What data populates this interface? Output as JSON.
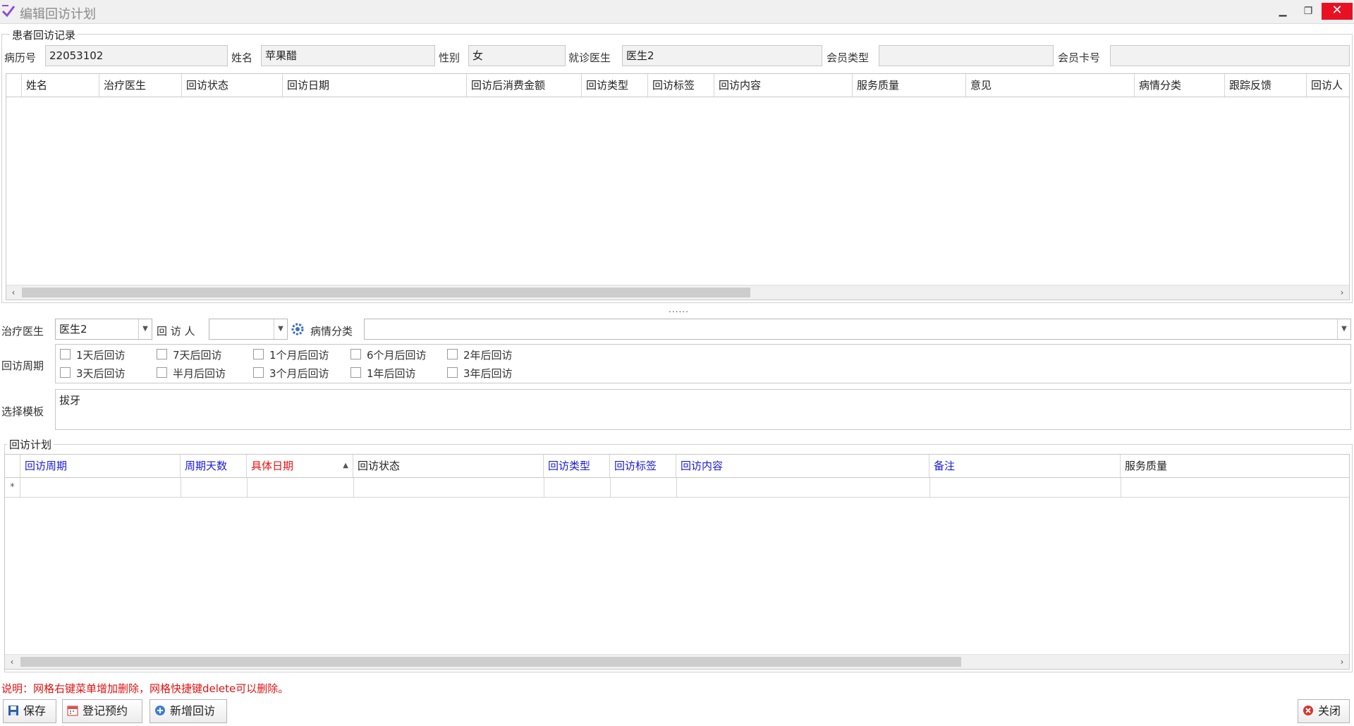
{
  "window": {
    "title": "编辑回访计划",
    "min_icon": "minimize-icon",
    "max_icon": "restore-icon",
    "close_icon": "close-icon"
  },
  "patient_group": {
    "legend": "患者回访记录",
    "fields": {
      "record_no_label": "病历号",
      "record_no": "22053102",
      "name_label": "姓名",
      "name": "苹果醋",
      "gender_label": "性别",
      "gender": "女",
      "doctor_label": "就诊医生",
      "doctor": "医生2",
      "member_type_label": "会员类型",
      "member_type": "",
      "member_card_label": "会员卡号",
      "member_card": ""
    },
    "grid_columns": [
      "姓名",
      "治疗医生",
      "回访状态",
      "回访日期",
      "回访后消费金额",
      "回访类型",
      "回访标签",
      "回访内容",
      "服务质量",
      "意见",
      "病情分类",
      "跟踪反馈",
      "回访人"
    ]
  },
  "splitter": "......",
  "form": {
    "treat_doctor_label": "治疗医生",
    "treat_doctor": "医生2",
    "visitor_label": "回 访 人",
    "visitor": "",
    "condition_label": "病情分类",
    "condition": "",
    "period_label": "回访周期",
    "periods_row1": [
      "1天后回访",
      "7天后回访",
      "1个月后回访",
      "6个月后回访",
      "2年后回访"
    ],
    "periods_row2": [
      "3天后回访",
      "半月后回访",
      "3个月后回访",
      "1年后回访",
      "3年后回访"
    ],
    "template_label": "选择模板",
    "template": "拔牙"
  },
  "plan_group": {
    "legend": "回访计划",
    "columns": [
      "回访周期",
      "周期天数",
      "具体日期",
      "回访状态",
      "回访类型",
      "回访标签",
      "回访内容",
      "备注",
      "服务质量"
    ],
    "new_row_marker": "*"
  },
  "note": "说明：网格右键菜单增加删除，网格快捷键delete可以删除。",
  "buttons": {
    "save": "保存",
    "register": "登记预约",
    "add": "新增回访",
    "close": "关闭"
  },
  "colors": {
    "note": "#e11111",
    "required_header": "#e11111",
    "editable_header": "#1a1adb",
    "close_accent": "#e81123"
  }
}
